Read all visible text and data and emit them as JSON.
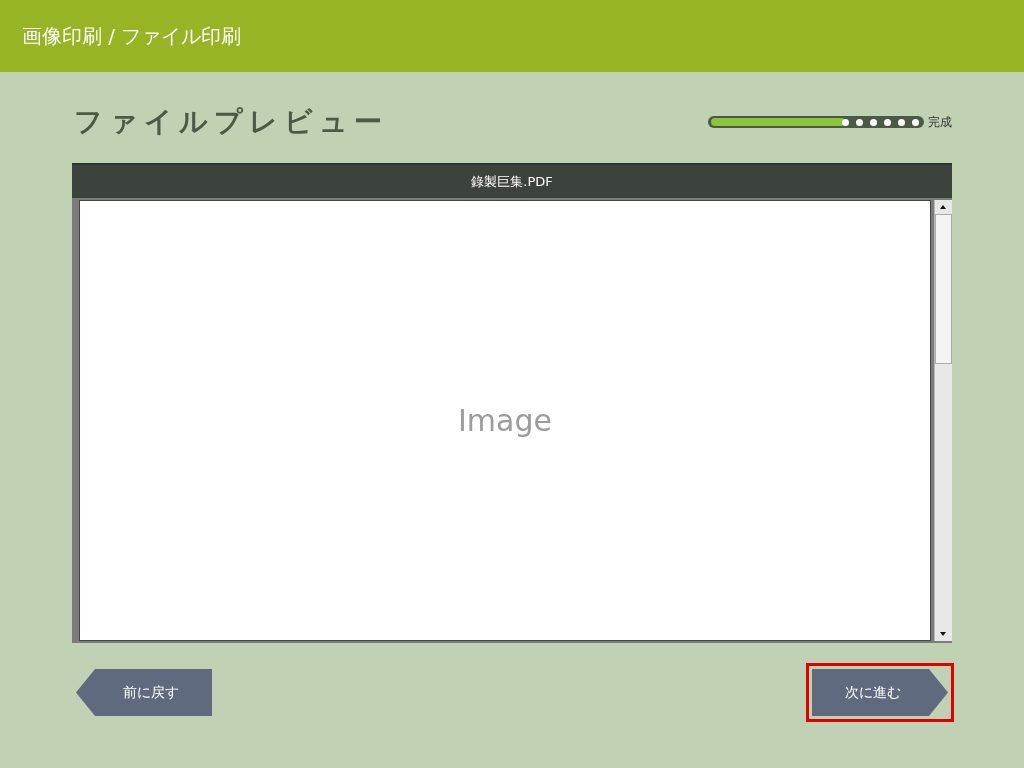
{
  "header": {
    "title": "画像印刷 / ファイル印刷"
  },
  "page": {
    "title": "ファイルプレビュー"
  },
  "progress": {
    "level": 0.64,
    "label": "完成"
  },
  "preview": {
    "file_name": "錄製巨集.PDF",
    "placeholder_text": "Image"
  },
  "buttons": [
    {
      "kind": "back",
      "label": "前に戻す",
      "highlighted": false
    },
    {
      "kind": "next",
      "label": "次に進む",
      "highlighted": true
    }
  ]
}
